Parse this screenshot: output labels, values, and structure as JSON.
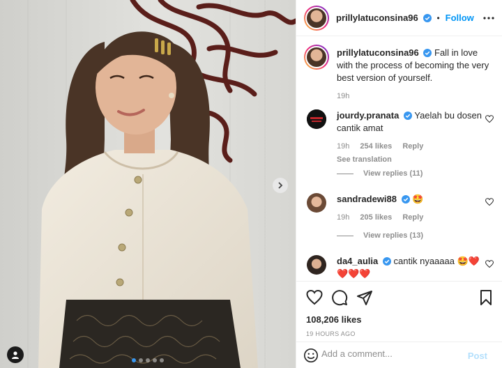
{
  "post": {
    "author": "prillylatuconsina96",
    "follow_label": "Follow",
    "separator": "•",
    "caption": "Fall in love with the process of becoming the very best version of yourself.",
    "caption_time": "19h",
    "likes": "108,206 likes",
    "timestamp": "19 HOURS AGO",
    "carousel": {
      "slide_count": 5,
      "active_slide": 1
    }
  },
  "comments": [
    {
      "user": "jourdy.pranata",
      "text": "Yaelah bu dosen cantik amat",
      "time": "19h",
      "likes": "254 likes",
      "reply": "Reply",
      "translation": "See translation",
      "view_replies": "View replies (11)"
    },
    {
      "user": "sandradewi88",
      "text": "🤩",
      "time": "19h",
      "likes": "205 likes",
      "reply": "Reply",
      "view_replies": "View replies (13)"
    },
    {
      "user": "da4_aulia",
      "text": "cantik nyaaaaa 🤩❤️ ❤️❤️❤️"
    }
  ],
  "add_comment": {
    "placeholder": "Add a comment...",
    "post_label": "Post"
  },
  "icons": {
    "verified": "verified-badge-icon",
    "more": "more-horizontal-icon",
    "like": "heart-icon",
    "comment": "comment-bubble-icon",
    "share": "paper-plane-icon",
    "save": "bookmark-icon",
    "emoji": "smiley-icon",
    "next": "chevron-right-icon",
    "tag": "person-tag-icon"
  },
  "colors": {
    "accent": "#0095f6",
    "verified": "#3897f0",
    "muted": "#8e8e8e",
    "text": "#262626"
  }
}
